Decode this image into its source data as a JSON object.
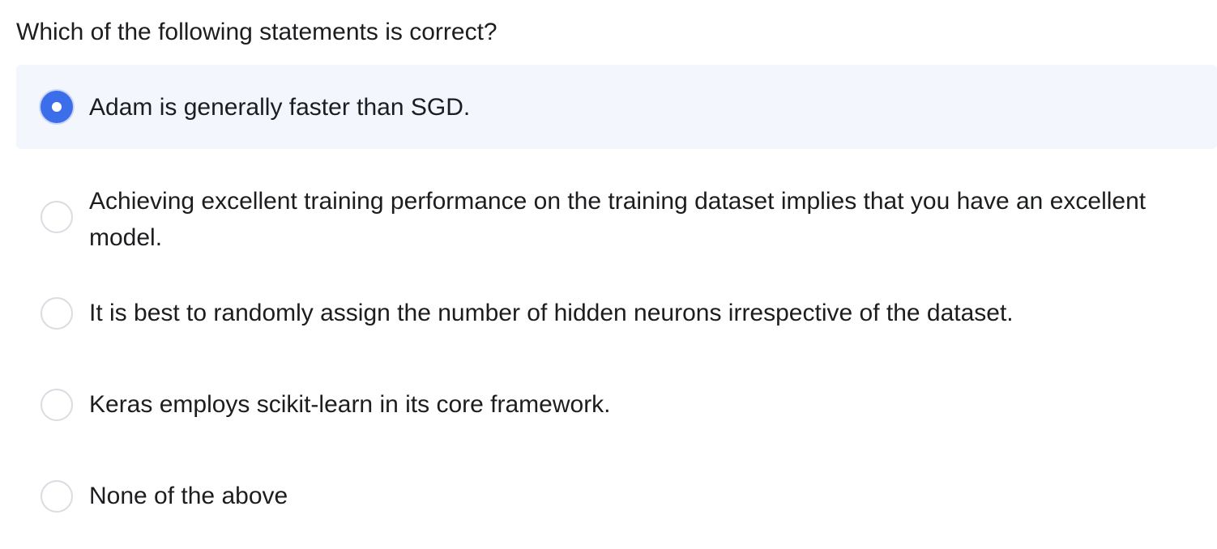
{
  "question": {
    "text": "Which of the following statements is correct?"
  },
  "options": [
    {
      "label": "Adam is generally faster than SGD.",
      "selected": true
    },
    {
      "label": "Achieving excellent training performance on the training dataset implies that you have an excellent model.",
      "selected": false
    },
    {
      "label": "It is best to randomly assign the number of hidden neurons irrespective of the dataset.",
      "selected": false
    },
    {
      "label": "Keras employs scikit-learn in its core framework.",
      "selected": false
    },
    {
      "label": "None of the above",
      "selected": false
    }
  ],
  "colors": {
    "accent": "#3b6ee8",
    "selected_background": "#f3f6fd",
    "radio_border": "#d9dce1",
    "text": "#1c1d1f"
  }
}
